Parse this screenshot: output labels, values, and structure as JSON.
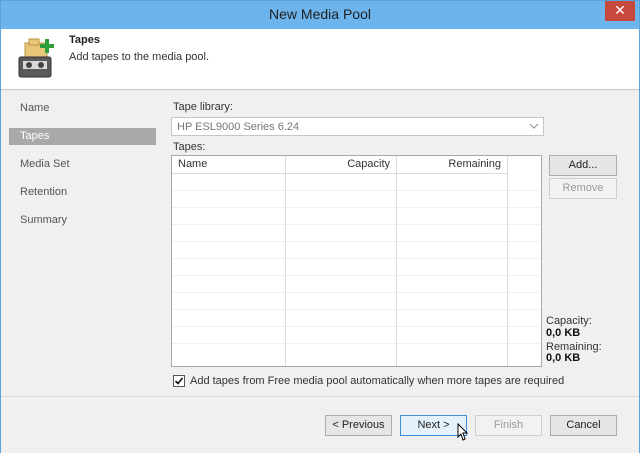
{
  "window": {
    "title": "New Media Pool",
    "close_icon": "close-icon"
  },
  "header": {
    "title": "Tapes",
    "description": "Add tapes to the media pool.",
    "icon": "tape-folder-add-icon"
  },
  "steps": [
    {
      "label": "Name",
      "active": false
    },
    {
      "label": "Tapes",
      "active": true
    },
    {
      "label": "Media Set",
      "active": false
    },
    {
      "label": "Retention",
      "active": false
    },
    {
      "label": "Summary",
      "active": false
    }
  ],
  "tape_library": {
    "label": "Tape library:",
    "value": "HP ESL9000 Series 6.24"
  },
  "tapes": {
    "label": "Tapes:",
    "columns": [
      "Name",
      "Capacity",
      "Remaining"
    ],
    "rows": []
  },
  "buttons": {
    "add": "Add...",
    "remove": "Remove"
  },
  "stats": {
    "capacity_label": "Capacity:",
    "capacity_value": "0,0 KB",
    "remaining_label": "Remaining:",
    "remaining_value": "0,0 KB"
  },
  "option": {
    "label": "Add tapes from Free media pool automatically when more tapes are required",
    "checked": true
  },
  "footer": {
    "previous": "< Previous",
    "next": "Next >",
    "finish": "Finish",
    "cancel": "Cancel"
  },
  "colors": {
    "titlebar": "#6db4ec",
    "close": "#c7483c",
    "active_step": "#a9a9a9"
  }
}
